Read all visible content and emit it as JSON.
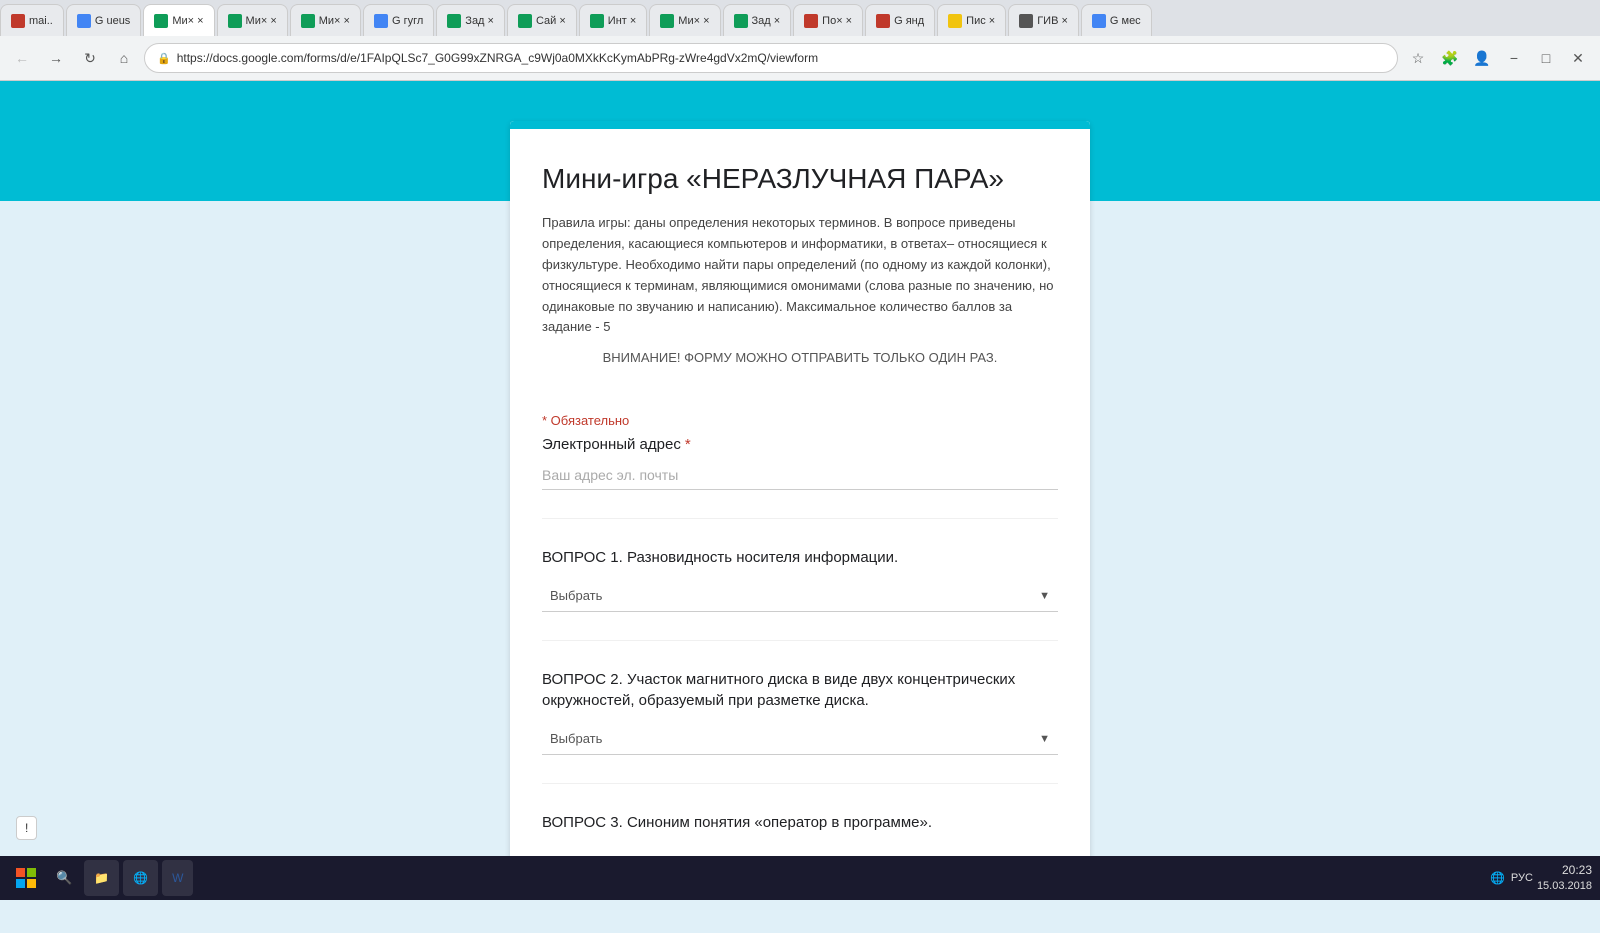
{
  "browser": {
    "tabs": [
      {
        "id": 1,
        "label": "mail.",
        "favicon_color": "#e74c3c",
        "active": false
      },
      {
        "id": 2,
        "label": "G ueus",
        "favicon_color": "#4285f4",
        "active": false
      },
      {
        "id": 3,
        "label": "Ми× ×",
        "favicon_color": "#0f9d58",
        "active": true
      },
      {
        "id": 4,
        "label": "Ми× ×",
        "favicon_color": "#0f9d58",
        "active": false
      },
      {
        "id": 5,
        "label": "Ми× ×",
        "favicon_color": "#0f9d58",
        "active": false
      },
      {
        "id": 6,
        "label": "G гугл",
        "favicon_color": "#4285f4",
        "active": false
      },
      {
        "id": 7,
        "label": "Зад ×",
        "favicon_color": "#0f9d58",
        "active": false
      },
      {
        "id": 8,
        "label": "Сай ×",
        "favicon_color": "#0f9d58",
        "active": false
      },
      {
        "id": 9,
        "label": "Инт ×",
        "favicon_color": "#0f9d58",
        "active": false
      },
      {
        "id": 10,
        "label": "Ми× ×",
        "favicon_color": "#0f9d58",
        "active": false
      },
      {
        "id": 11,
        "label": "Зад ×",
        "favicon_color": "#0f9d58",
        "active": false
      },
      {
        "id": 12,
        "label": "По× ×",
        "favicon_color": "#e74c3c",
        "active": false
      },
      {
        "id": 13,
        "label": "G янд",
        "favicon_color": "#4285f4",
        "active": false
      },
      {
        "id": 14,
        "label": "Пис ×",
        "favicon_color": "#f1c40f",
        "active": false
      },
      {
        "id": 15,
        "label": "ГИВ ×",
        "favicon_color": "#333",
        "active": false
      },
      {
        "id": 16,
        "label": "G мес",
        "favicon_color": "#4285f4",
        "active": false
      }
    ],
    "address": "https://docs.google.com/forms/d/e/1FAIpQLSc7_G0G99xZNRGA_c9Wj0a0MXkKcKymAbPRg-zWre4gdVx2mQ/viewform"
  },
  "form": {
    "title": "Мини-игра «НЕРАЗЛУЧНАЯ ПАРА»",
    "description": "Правила игры: даны определения некоторых терминов. В вопросе приведены  определения, касающиеся компьютеров и информатики, в ответах– относящиеся к физкультуре. Необходимо найти пары определений (по одному из каждой колонки), относящиеся к терминам, являющимися омонимами (слова разные по значению, но одинаковые по звучанию и написанию). Максимальное количество баллов за задание - 5",
    "warning": "ВНИМАНИЕ! ФОРМУ МОЖНО ОТПРАВИТЬ ТОЛЬКО ОДИН РАЗ.",
    "required_note": "* Обязательно",
    "email_label": "Электронный адрес",
    "email_placeholder": "Ваш адрес эл. почты",
    "q1_label": "ВОПРОС 1. Разновидность носителя информации.",
    "q2_label": "ВОПРОС 2. Участок магнитного диска в виде двух концентрических окружностей, образуемый при разметке диска.",
    "q3_label": "ВОПРОС 3. Синоним понятия «оператор в программе».",
    "dropdown_placeholder": "Выбрать"
  },
  "taskbar": {
    "apps": [
      {
        "label": "Проводник",
        "color": "#f0a500"
      },
      {
        "label": "Chrome",
        "color": "#4285f4"
      },
      {
        "label": "Word",
        "color": "#2b579a"
      }
    ],
    "time": "20:23",
    "date": "15.03.2018",
    "lang": "РУС"
  }
}
